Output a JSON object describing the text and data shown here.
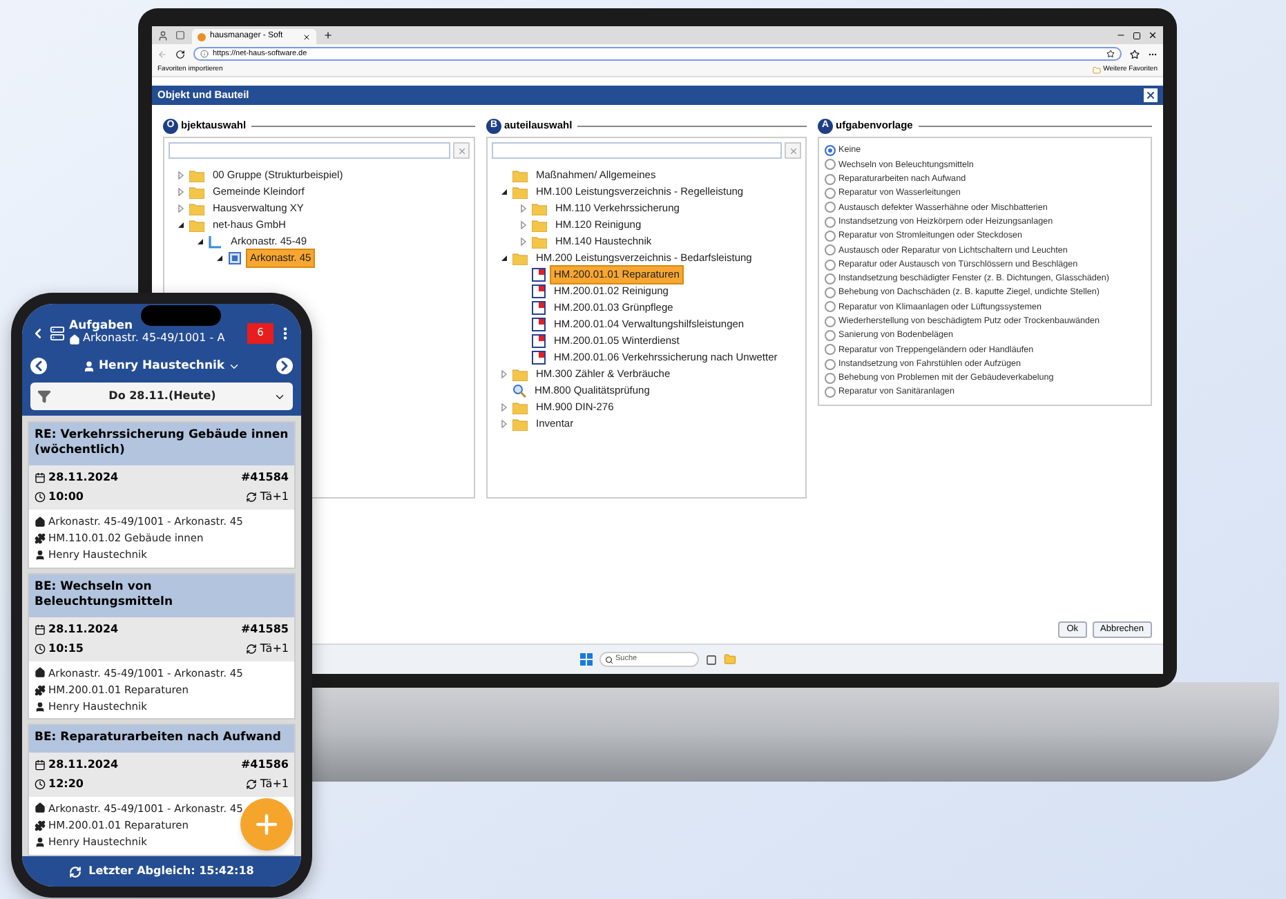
{
  "browser": {
    "tab_title": "hausmanager - Soft",
    "url": "https://net-haus-software.de",
    "favorites_left": "Favoriten importieren",
    "favorites_right": "Weitere Favoriten"
  },
  "dialog": {
    "title": "Objekt und Bauteil",
    "panels": [
      {
        "initial": "O",
        "heading": "bjektauswahl",
        "tree": [
          {
            "label": "00 Gruppe (Strukturbeispiel)",
            "kind": "folder",
            "expanded": false,
            "selected": false
          },
          {
            "label": "Gemeinde Kleindorf",
            "kind": "folder",
            "expanded": false,
            "selected": false
          },
          {
            "label": "Hausverwaltung XY",
            "kind": "folder",
            "expanded": false,
            "selected": false
          },
          {
            "label": "net-haus GmbH",
            "kind": "folder",
            "expanded": true,
            "selected": false,
            "children": [
              {
                "label": "Arkonastr. 45-49",
                "kind": "building",
                "expanded": true,
                "selected": false,
                "children": [
                  {
                    "label": "Arkonastr. 45",
                    "kind": "unit",
                    "expanded": true,
                    "selected": true
                  }
                ]
              }
            ]
          }
        ]
      },
      {
        "initial": "B",
        "heading": "auteilauswahl",
        "tree": [
          {
            "label": "Maßnahmen/ Allgemeines",
            "kind": "folder",
            "selected": false
          },
          {
            "label": "HM.100 Leistungsverzeichnis - Regelleistung",
            "kind": "folder",
            "expanded": true,
            "selected": false,
            "children": [
              {
                "label": "HM.110 Verkehrssicherung",
                "kind": "folder",
                "expanded": false,
                "selected": false
              },
              {
                "label": "HM.120 Reinigung",
                "kind": "folder",
                "expanded": false,
                "selected": false
              },
              {
                "label": "HM.140 Haustechnik",
                "kind": "folder",
                "expanded": false,
                "selected": false
              }
            ]
          },
          {
            "label": "HM.200 Leistungsverzeichnis - Bedarfsleistung",
            "kind": "folder",
            "expanded": true,
            "selected": false,
            "children": [
              {
                "label": "HM.200.01.01 Reparaturen",
                "kind": "task",
                "selected": true
              },
              {
                "label": "HM.200.01.02 Reinigung",
                "kind": "task",
                "selected": false
              },
              {
                "label": "HM.200.01.03 Grünpflege",
                "kind": "task",
                "selected": false
              },
              {
                "label": "HM.200.01.04 Verwaltungshilfsleistungen",
                "kind": "task",
                "selected": false
              },
              {
                "label": "HM.200.01.05 Winterdienst",
                "kind": "task",
                "selected": false
              },
              {
                "label": "HM.200.01.06 Verkehrssicherung nach Unwetter",
                "kind": "task",
                "selected": false
              }
            ]
          },
          {
            "label": "HM.300 Zähler & Verbräuche",
            "kind": "folder",
            "expanded": false,
            "selected": false
          },
          {
            "label": "HM.800 Qualitätsprüfung",
            "kind": "search",
            "selected": false
          },
          {
            "label": "HM.900 DIN-276",
            "kind": "folder",
            "expanded": false,
            "selected": false
          },
          {
            "label": "Inventar",
            "kind": "folder",
            "expanded": false,
            "selected": false
          }
        ]
      }
    ],
    "templates": {
      "initial": "A",
      "heading": "ufgabenvorlage",
      "options": [
        {
          "label": "Keine",
          "selected": true
        },
        {
          "label": "Wechseln von Beleuchtungsmitteln",
          "selected": false
        },
        {
          "label": "Reparaturarbeiten nach Aufwand",
          "selected": false
        },
        {
          "label": "Reparatur von Wasserleitungen",
          "selected": false
        },
        {
          "label": "Austausch defekter Wasserhähne oder Mischbatterien",
          "selected": false
        },
        {
          "label": "Instandsetzung von Heizkörpern oder Heizungsanlagen",
          "selected": false
        },
        {
          "label": "Reparatur von Stromleitungen oder Steckdosen",
          "selected": false
        },
        {
          "label": "Austausch oder Reparatur von Lichtschaltern und Leuchten",
          "selected": false
        },
        {
          "label": "Reparatur oder Austausch von Türschlössern und Beschlägen",
          "selected": false
        },
        {
          "label": "Instandsetzung beschädigter Fenster (z. B. Dichtungen, Glasschäden)",
          "selected": false
        },
        {
          "label": "Behebung von Dachschäden (z. B. kaputte Ziegel, undichte Stellen)",
          "selected": false
        },
        {
          "label": "Reparatur von Klimaanlagen oder Lüftungssystemen",
          "selected": false
        },
        {
          "label": "Wiederherstellung von beschädigtem Putz oder Trockenbauwänden",
          "selected": false
        },
        {
          "label": "Sanierung von Bodenbelägen",
          "selected": false
        },
        {
          "label": "Reparatur von Treppengeländern oder Handläufen",
          "selected": false
        },
        {
          "label": "Instandsetzung von Fahrstühlen oder Aufzügen",
          "selected": false
        },
        {
          "label": "Behebung von Problemen mit der Gebäudeverkabelung",
          "selected": false
        },
        {
          "label": "Reparatur von Sanitäranlagen",
          "selected": false
        }
      ]
    },
    "buttons": [
      "Ok",
      "Abbrechen"
    ]
  },
  "taskbar": {
    "search_placeholder": "Suche"
  },
  "phone": {
    "title": "Aufgaben",
    "subtitle": "Arkonastr. 45-49/1001 - A",
    "badge": "6",
    "user": "Henry Haustechnik",
    "filter": "Do 28.11.(Heute)",
    "tasks": [
      {
        "title": "RE: Verkehrssicherung Gebäude innen (wöchentlich)",
        "date": "28.11.2024",
        "number": "#41584",
        "time": "10:00",
        "repeat": "Tä+1",
        "location": "Arkonastr. 45-49/1001 - Arkonastr. 45",
        "component": "HM.110.01.02 Gebäude innen",
        "person": "Henry Haustechnik"
      },
      {
        "title": "BE: Wechseln von Beleuchtungsmitteln",
        "date": "28.11.2024",
        "number": "#41585",
        "time": "10:15",
        "repeat": "Tä+1",
        "location": "Arkonastr. 45-49/1001 - Arkonastr. 45",
        "component": "HM.200.01.01 Reparaturen",
        "person": "Henry Haustechnik"
      },
      {
        "title": "BE: Reparaturarbeiten nach Aufwand",
        "date": "28.11.2024",
        "number": "#41586",
        "time": "12:20",
        "repeat": "Tä+1",
        "location": "Arkonastr. 45-49/1001 - Arkonastr. 45",
        "component": "HM.200.01.01 Reparaturen",
        "person": "Henry Haustechnik"
      }
    ],
    "footer": "Letzter Abgleich: 15:42:18"
  }
}
